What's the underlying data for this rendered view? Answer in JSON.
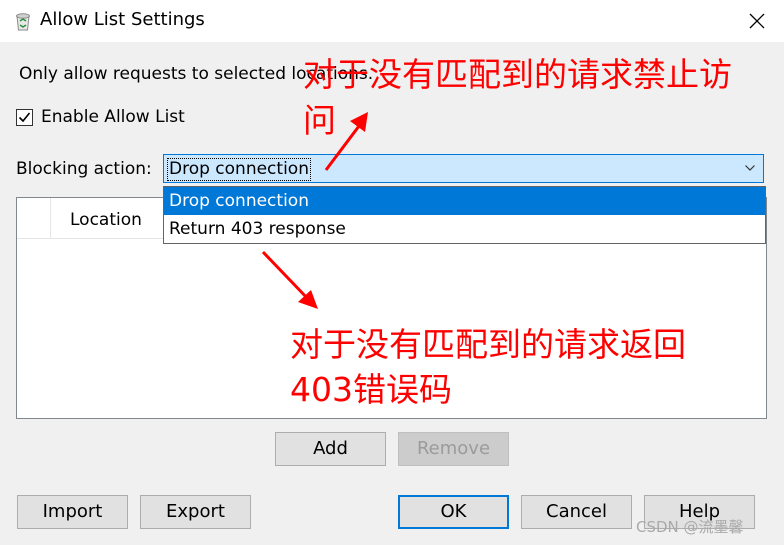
{
  "window": {
    "title": "Allow List Settings",
    "app_icon": "recycle-bin-icon",
    "close_icon": "close-icon"
  },
  "description": "Only allow requests to selected locations.",
  "enable_allow_list": {
    "label": "Enable Allow List",
    "checked": true
  },
  "blocking_action": {
    "label": "Blocking action:",
    "selected": "Drop connection",
    "options": [
      "Drop connection",
      "Return 403 response"
    ]
  },
  "location_list": {
    "columns": [
      "Location"
    ],
    "rows": []
  },
  "buttons": {
    "add": "Add",
    "remove": "Remove",
    "import": "Import",
    "export": "Export",
    "ok": "OK",
    "cancel": "Cancel",
    "help": "Help"
  },
  "annotations": {
    "note1_line1": "对于没有匹配到的请求禁止访",
    "note1_line2": "问",
    "note2_line1": "对于没有匹配到的请求返回",
    "note2_line2": "403错误码",
    "color": "#ff0000"
  },
  "watermark": "CSDN @流墨馨",
  "colors": {
    "accent": "#0078d7",
    "combo_bg": "#cce8ff",
    "dialog_bg": "#f0f0f0"
  }
}
